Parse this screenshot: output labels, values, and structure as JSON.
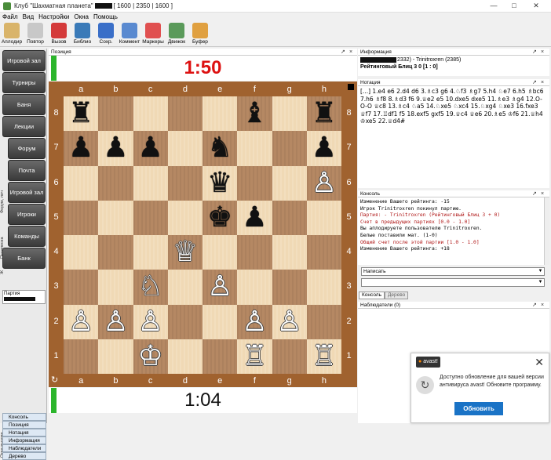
{
  "window": {
    "title_prefix": "Клуб \"Шахматная планета\"",
    "title_suffix": "[ 1600 | 2350 | 1600 ]",
    "min": "—",
    "max": "□",
    "close": "✕"
  },
  "menu": [
    "Файл",
    "Вид",
    "Настройки",
    "Окна",
    "Помощь"
  ],
  "toolbar": [
    {
      "label": "Аплодир",
      "icon": "applause-icon",
      "color": "#d9b46a"
    },
    {
      "label": "Повтор",
      "icon": "repeat-icon",
      "color": "#c8c8c8"
    },
    {
      "label": "Вызов",
      "icon": "dice-icon",
      "color": "#d43a3a"
    },
    {
      "label": "Библио",
      "icon": "library-icon",
      "color": "#3a7ab8"
    },
    {
      "label": "Сохр.",
      "icon": "save-icon",
      "color": "#3a6fc8"
    },
    {
      "label": "Коммент",
      "icon": "pencil-icon",
      "color": "#5a8ad0"
    },
    {
      "label": "Маркеры",
      "icon": "markers-icon",
      "color": "#e05050"
    },
    {
      "label": "Движок",
      "icon": "engine-icon",
      "color": "#5a9a5a"
    },
    {
      "label": "Буфер",
      "icon": "clipboard-icon",
      "color": "#e0a040"
    }
  ],
  "sidebar": {
    "buttons": [
      "Игровой зал",
      "Турниры",
      "Баня",
      "Лекции",
      "Форум",
      "Почта",
      "Игровой зал",
      "Игроки",
      "Команды",
      "Банк"
    ],
    "extra": "Партия",
    "vertical_labels": [
      "Форум, лич",
      "Переписка",
      "Ж"
    ],
    "bottom_tabs": [
      "Консоль",
      "Позиция",
      "Нотация",
      "Информация",
      "Наблюдатели",
      "Дерево"
    ],
    "bottom_vertical": "Окна вызова"
  },
  "position_panel": {
    "title": "Позиция",
    "clock_top": "1:50",
    "clock_bottom": "1:04"
  },
  "board": {
    "files": [
      "a",
      "b",
      "c",
      "d",
      "e",
      "f",
      "g",
      "h"
    ],
    "ranks": [
      "8",
      "7",
      "6",
      "5",
      "4",
      "3",
      "2",
      "1"
    ],
    "pieces": [
      {
        "sq": "a8",
        "p": "♜",
        "c": "b"
      },
      {
        "sq": "f8",
        "p": "♝",
        "c": "b"
      },
      {
        "sq": "h8",
        "p": "♜",
        "c": "b"
      },
      {
        "sq": "a7",
        "p": "♟",
        "c": "b"
      },
      {
        "sq": "b7",
        "p": "♟",
        "c": "b"
      },
      {
        "sq": "c7",
        "p": "♟",
        "c": "b"
      },
      {
        "sq": "e7",
        "p": "♞",
        "c": "b"
      },
      {
        "sq": "h7",
        "p": "♟",
        "c": "b"
      },
      {
        "sq": "e6",
        "p": "♛",
        "c": "b"
      },
      {
        "sq": "h6",
        "p": "♙",
        "c": "w"
      },
      {
        "sq": "e5",
        "p": "♚",
        "c": "b"
      },
      {
        "sq": "f5",
        "p": "♟",
        "c": "b"
      },
      {
        "sq": "d4",
        "p": "♕",
        "c": "w"
      },
      {
        "sq": "c3",
        "p": "♘",
        "c": "w"
      },
      {
        "sq": "e3",
        "p": "♙",
        "c": "w"
      },
      {
        "sq": "a2",
        "p": "♙",
        "c": "w"
      },
      {
        "sq": "b2",
        "p": "♙",
        "c": "w"
      },
      {
        "sq": "c2",
        "p": "♙",
        "c": "w"
      },
      {
        "sq": "f2",
        "p": "♙",
        "c": "w"
      },
      {
        "sq": "g2",
        "p": "♙",
        "c": "w"
      },
      {
        "sq": "c1",
        "p": "♔",
        "c": "w"
      },
      {
        "sq": "f1",
        "p": "♖",
        "c": "w"
      },
      {
        "sq": "h1",
        "p": "♖",
        "c": "w"
      }
    ]
  },
  "info_panel": {
    "title": "Информация",
    "players": "2332) - Trinitroxren (2385)",
    "event": "Рейтинговый Блиц 3 0 [1 : 0]"
  },
  "notation_panel": {
    "title": "Нотация",
    "moves": "[...] 1.e4 e6 2.d4 d6 3.♗c3 g6 4.♘f3 ♗g7 5.h4 ♘e7 6.h5 ♗bc6 7.h6 ♗f8 8.♗d3 f6 9.♕e2 e5 10.dxe5 dxe5 11.♗e3 ♗g4 12.O-O-O ♕c8 13.♗c4 ♘a5 14.♘xe5 ♘xc4 15.♘xg4 ♘xe3 16.fxe3 ♕f7 17.♖df1 f5 18.exf5 gxf5 19.♕c4 ♕e6 20.♗e5 ♔f6 21.♕h4 ♔xe5 22.♕d4#"
  },
  "console_panel": {
    "title": "Консоль",
    "lines": [
      {
        "t": "Изменение Вашего рейтинга: -15",
        "red": false
      },
      {
        "t": "Игрок Trinitroxren покинул партию.",
        "red": false
      },
      {
        "t": "Партия:           - Trinitroxren (Рейтинговый Блиц 3 + 0)",
        "red": true
      },
      {
        "t": "Счет в предыдущих партиях [0.0 - 1.0]",
        "red": true
      },
      {
        "t": "Вы аплодируете пользователю Trinitroxren.",
        "red": false
      },
      {
        "t": "Белые поставили мат. (1-0)",
        "red": false
      },
      {
        "t": "Общий счет после этой партии [1.0 - 1.0]",
        "red": true
      },
      {
        "t": "Изменение Вашего рейтинга: +18",
        "red": false
      }
    ],
    "write_label": "Написать",
    "tabs": [
      "Консоль",
      "Дерево"
    ]
  },
  "observers_panel": {
    "title": "Наблюдатели (0)"
  },
  "avast": {
    "brand": "avast!",
    "message": "Доступно обновление для вашей версии антивируса avast! Обновите программу.",
    "button": "Обновить"
  }
}
